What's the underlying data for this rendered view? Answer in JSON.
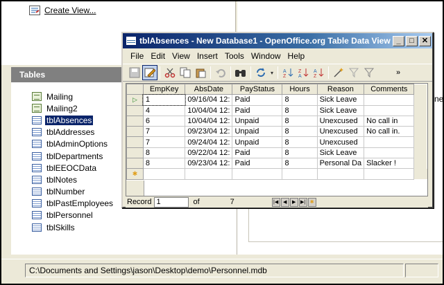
{
  "main": {
    "create_view": "Create View...",
    "tables_header": "Tables",
    "right_peek": "ne"
  },
  "tables": [
    {
      "name": "Mailing",
      "icon": "form-icon"
    },
    {
      "name": "Mailing2",
      "icon": "form-icon"
    },
    {
      "name": "tblAbsences",
      "icon": "table-icon",
      "selected": true
    },
    {
      "name": "tblAddresses",
      "icon": "table-icon"
    },
    {
      "name": "tblAdminOptions",
      "icon": "table-icon"
    },
    {
      "name": "tblDepartments",
      "icon": "table-icon"
    },
    {
      "name": "tblEEOCData",
      "icon": "table-icon"
    },
    {
      "name": "tblNotes",
      "icon": "table-icon"
    },
    {
      "name": "tblNumber",
      "icon": "table-icon"
    },
    {
      "name": "tblPastEmployees",
      "icon": "table-icon"
    },
    {
      "name": "tblPersonnel",
      "icon": "table-icon"
    },
    {
      "name": "tblSkills",
      "icon": "table-icon"
    }
  ],
  "status": {
    "path": "C:\\Documents and Settings\\jason\\Desktop\\demo\\Personnel.mdb"
  },
  "window": {
    "title": "tblAbsences - New Database1 - OpenOffice.org Table Data View",
    "buttons": {
      "minimize": "_",
      "maximize": "□",
      "close": "✕"
    },
    "menu": [
      "File",
      "Edit",
      "View",
      "Insert",
      "Tools",
      "Window",
      "Help"
    ],
    "toolbar_icons": [
      "save-icon",
      "edit-icon",
      "cut-icon",
      "copy-icon",
      "paste-icon",
      "undo-icon",
      "find-icon",
      "refresh-icon",
      "sort-ascending-icon",
      "sort-descending-icon",
      "autofilter-icon",
      "standard-filter-icon",
      "remove-filter-icon",
      "overflow-icon"
    ]
  },
  "grid": {
    "columns": [
      "EmpKey",
      "AbsDate",
      "PayStatus",
      "Hours",
      "Reason",
      "Comments"
    ],
    "rows": [
      [
        "1",
        "09/16/04 12:",
        "Paid",
        "8",
        "Sick Leave",
        ""
      ],
      [
        "4",
        "10/04/04 12:",
        "Paid",
        "8",
        "Sick Leave",
        ""
      ],
      [
        "6",
        "10/04/04 12:",
        "Unpaid",
        "8",
        "Unexcused",
        "No call in"
      ],
      [
        "7",
        "09/23/04 12:",
        "Unpaid",
        "8",
        "Unexcused",
        "No call in."
      ],
      [
        "7",
        "09/24/04 12:",
        "Unpaid",
        "8",
        "Unexcused",
        ""
      ],
      [
        "8",
        "09/22/04 12:",
        "Paid",
        "8",
        "Sick Leave",
        ""
      ],
      [
        "8",
        "09/23/04 12:",
        "Paid",
        "8",
        "Personal Da",
        "Slacker !"
      ]
    ]
  },
  "nav": {
    "record_label": "Record",
    "record_value": "1",
    "of_label": "of",
    "total": "7"
  }
}
